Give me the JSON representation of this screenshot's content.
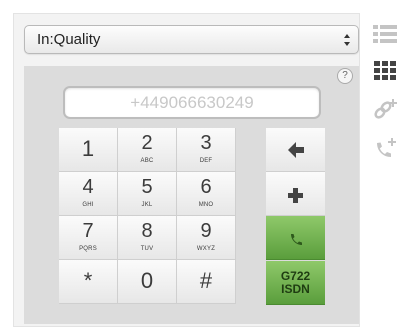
{
  "quality_select": {
    "value": "In:Quality"
  },
  "dial": {
    "number_placeholder": "+449066630249",
    "help_label": "?"
  },
  "keypad": [
    {
      "digit": "1",
      "letters": ""
    },
    {
      "digit": "2",
      "letters": "ABC"
    },
    {
      "digit": "3",
      "letters": "DEF"
    },
    {
      "digit": "4",
      "letters": "GHI"
    },
    {
      "digit": "5",
      "letters": "JKL"
    },
    {
      "digit": "6",
      "letters": "MNO"
    },
    {
      "digit": "7",
      "letters": "PQRS"
    },
    {
      "digit": "8",
      "letters": "TUV"
    },
    {
      "digit": "9",
      "letters": "WXYZ"
    },
    {
      "digit": "*",
      "letters": ""
    },
    {
      "digit": "0",
      "letters": ""
    },
    {
      "digit": "#",
      "letters": ""
    }
  ],
  "actions": {
    "codec_line1": "G722",
    "codec_line2": "ISDN"
  },
  "icons": {
    "list": "list-icon",
    "grid": "grid-icon",
    "link_add": "link-add-icon",
    "call_add": "call-add-icon",
    "backspace": "backspace-arrow-icon",
    "plus": "plus-icon",
    "phone": "phone-icon"
  },
  "colors": {
    "call_green": "#6aae47",
    "icon_gray": "#c4c4c4",
    "icon_dark": "#444444"
  }
}
